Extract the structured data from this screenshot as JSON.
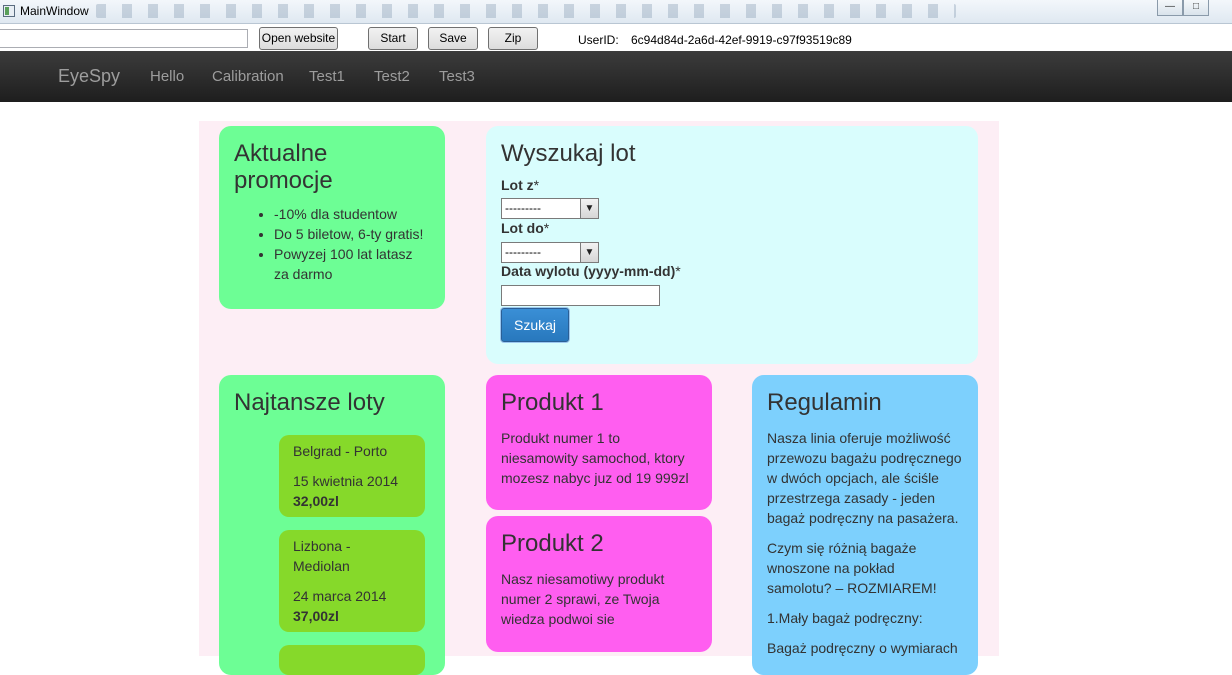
{
  "window": {
    "title": "MainWindow"
  },
  "toolbar": {
    "url_value": "",
    "open_label": "Open website",
    "start_label": "Start",
    "save_label": "Save",
    "zip_label": "Zip",
    "userid_label": "UserID:",
    "userid_value": "6c94d84d-2a6d-42ef-9919-c97f93519c89"
  },
  "navbar": {
    "brand": "EyeSpy",
    "links": [
      "Hello",
      "Calibration",
      "Test1",
      "Test2",
      "Test3"
    ]
  },
  "promo": {
    "title": "Aktualne promocje",
    "items": [
      "-10% dla studentow",
      "Do 5 biletow, 6-ty gratis!",
      "Powyzej 100 lat latasz za darmo"
    ]
  },
  "search": {
    "title": "Wyszukaj lot",
    "from_label": "Lot z",
    "to_label": "Lot do",
    "date_label": "Data wylotu (yyyy-mm-dd)",
    "required_mark": "*",
    "from_value": "---------",
    "to_value": "---------",
    "date_value": "",
    "button_label": "Szukaj"
  },
  "cheapest": {
    "title": "Najtansze loty",
    "flights": [
      {
        "route": "Belgrad - Porto",
        "date": "15 kwietnia 2014",
        "price": "32,00zl"
      },
      {
        "route": "Lizbona - Mediolan",
        "date": "24 marca 2014",
        "price": "37,00zl"
      }
    ]
  },
  "product1": {
    "title": "Produkt 1",
    "text": "Produkt numer 1 to niesamowity samochod, ktory mozesz nabyc juz od 19 999zl"
  },
  "product2": {
    "title": "Produkt 2",
    "text": "Nasz niesamotiwy produkt numer 2 sprawi, ze Twoja wiedza podwoi sie"
  },
  "rules": {
    "title": "Regulamin",
    "p1": "Nasza linia oferuje możliwość przewozu bagażu podręcznego w dwóch opcjach, ale ściśle przestrzega zasady - jeden bagaż podręczny na pasażera.",
    "p2": "Czym się różnią bagaże wnoszone na pokład samolotu? – ROZMIAREM!",
    "p3": "1.Mały bagaż podręczny:",
    "p4": "Bagaż podręczny o wymiarach"
  },
  "colors": {
    "promo_bg": "#6dfe95",
    "search_bg": "#d9fdfd",
    "product_bg": "#ff5ef0",
    "rules_bg": "#7dd0fd",
    "flight_bg": "#86d92a",
    "page_bg": "#fdeef5",
    "navbar_bg": "#2a2a2a"
  }
}
